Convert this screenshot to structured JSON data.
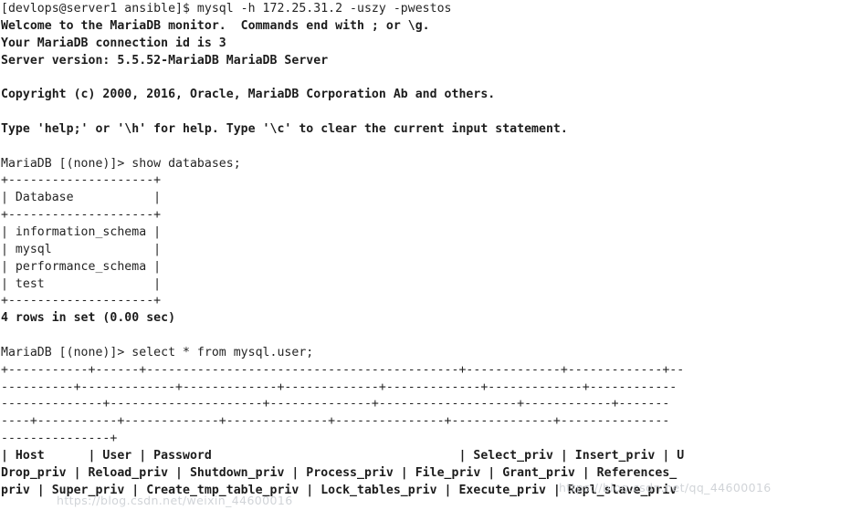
{
  "terminal": {
    "app": "mysql-client-terminal",
    "background_color": "#ffffff",
    "foreground_color": "#1c1c1c",
    "prompt_user_host": "[devlops@server1 ansible]$",
    "command": "mysql -h 172.25.31.2 -uszy -pwestos",
    "connection": {
      "welcome": "Welcome to the MariaDB monitor.  Commands end with ; or \\g.",
      "connection_id_text": "Your MariaDB connection id is 3",
      "connection_id": "3",
      "server_version_text": "Server version: 5.5.52-MariaDB MariaDB Server",
      "server_version": "5.5.52-MariaDB",
      "copyright": "Copyright (c) 2000, 2016, Oracle, MariaDB Corporation Ab and others.",
      "help_hint": "Type 'help;' or '\\h' for help. Type '\\c' to clear the current input statement."
    },
    "prompt_label": "MariaDB [(none)]>",
    "commands": {
      "show_databases": "show databases;",
      "select_user": "select * from mysql.user;"
    },
    "databases_result": {
      "border": "+--------------------+",
      "header_row": "| Database           |",
      "header": "Database",
      "rows": [
        "| information_schema |",
        "| mysql              |",
        "| performance_schema |",
        "| test               |"
      ],
      "values": [
        "information_schema",
        "mysql",
        "performance_schema",
        "test"
      ],
      "status": "4 rows in set (0.00 sec)",
      "row_count": "4",
      "duration": "0.00 sec"
    },
    "user_table": {
      "separator_lines": [
        "+-----------+------+-------------------------------------------+-------------+-------------+--",
        "----------+-------------+-------------+-------------+-------------+-------------+------------",
        "--------------+---------------------+--------------+-------------------+------------+-------",
        "----+-----------+-------------+--------------+---------------+--------------+---------------",
        "---------------+"
      ],
      "header_lines": [
        "| Host      | User | Password                                  | Select_priv | Insert_priv | U",
        "Drop_priv | Reload_priv | Shutdown_priv | Process_priv | File_priv | Grant_priv | References_",
        "priv | Super_priv | Create_tmp_table_priv | Lock_tables_priv | Execute_priv | Repl_slave_priv"
      ],
      "columns": [
        "Host",
        "User",
        "Password",
        "Select_priv",
        "Insert_priv",
        "Drop_priv",
        "Reload_priv",
        "Shutdown_priv",
        "Process_priv",
        "File_priv",
        "Grant_priv",
        "References_priv",
        "Super_priv",
        "Create_tmp_table_priv",
        "Lock_tables_priv",
        "Execute_priv",
        "Repl_slave_priv"
      ]
    },
    "watermark": {
      "line1": "https://blog.csdn.net/qq_44600016",
      "line2": "https://blog.csdn.net/weixin_44600016"
    }
  }
}
